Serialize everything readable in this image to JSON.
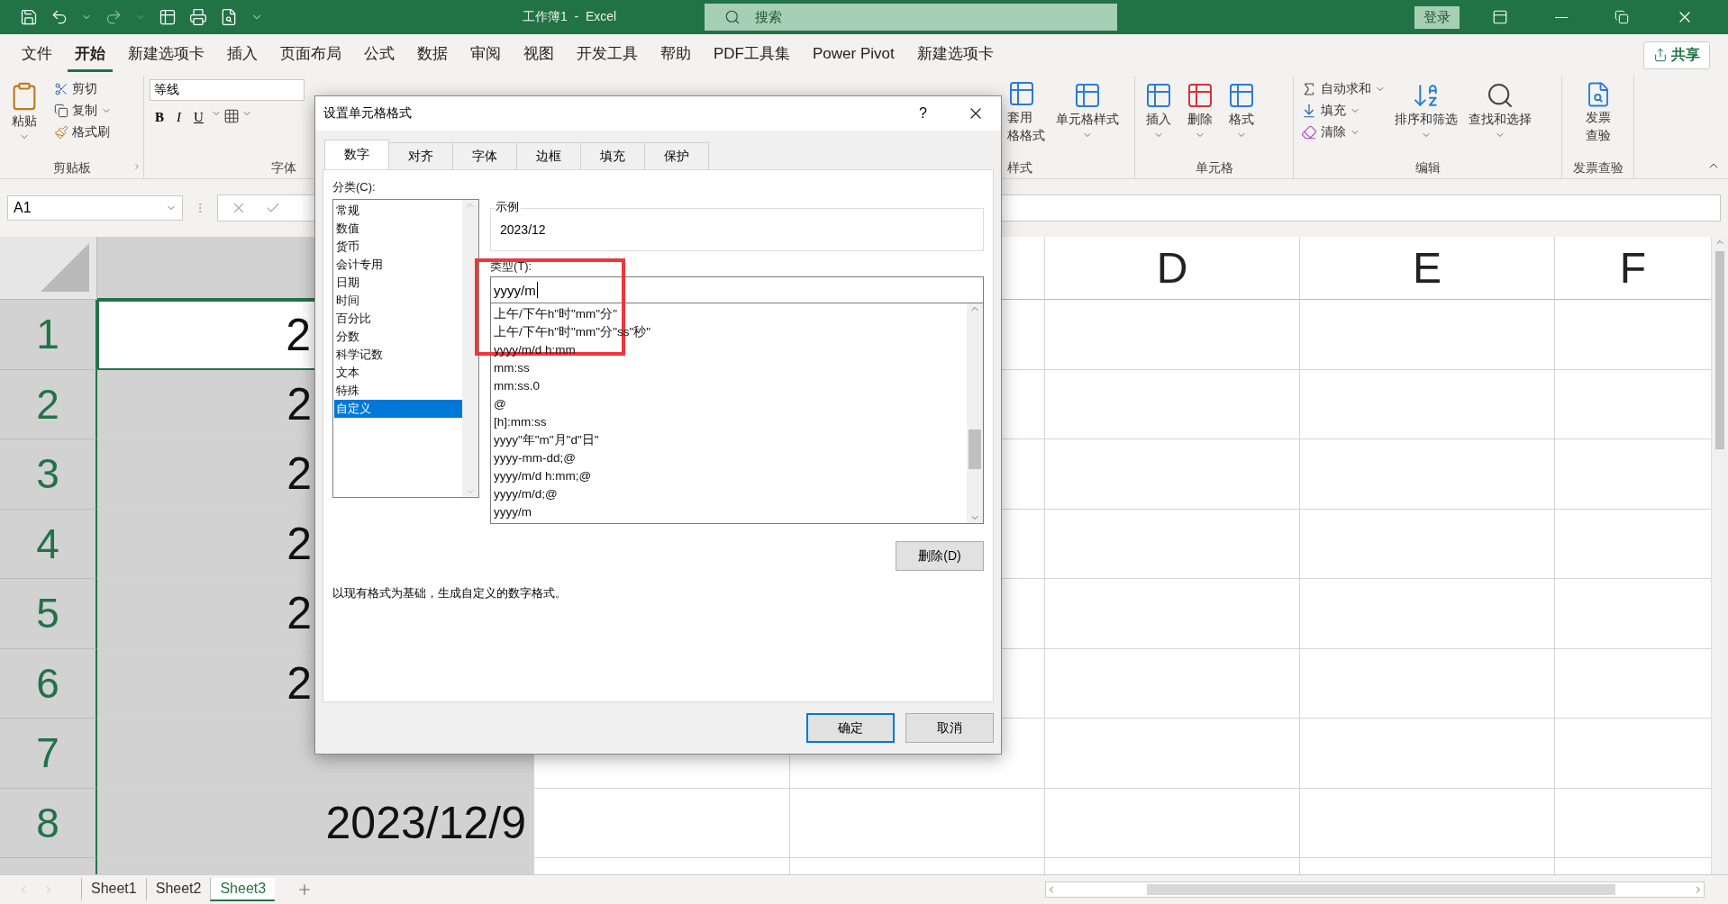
{
  "title_bar": {
    "title": "工作簿1  -  Excel",
    "search_placeholder": "搜索",
    "sign_in": "登录"
  },
  "menu_tabs": [
    {
      "label": "文件",
      "selected": false
    },
    {
      "label": "开始",
      "selected": true
    },
    {
      "label": "新建选项卡",
      "selected": false
    },
    {
      "label": "插入",
      "selected": false
    },
    {
      "label": "页面布局",
      "selected": false
    },
    {
      "label": "公式",
      "selected": false
    },
    {
      "label": "数据",
      "selected": false
    },
    {
      "label": "审阅",
      "selected": false
    },
    {
      "label": "视图",
      "selected": false
    },
    {
      "label": "开发工具",
      "selected": false
    },
    {
      "label": "帮助",
      "selected": false
    },
    {
      "label": "PDF工具集",
      "selected": false
    },
    {
      "label": "Power Pivot",
      "selected": false
    },
    {
      "label": "新建选项卡",
      "selected": false
    }
  ],
  "share": "共享",
  "ribbon_left": {
    "paste": "粘贴",
    "cut": "剪切",
    "copy": "复制",
    "format_painter": "格式刷",
    "clipboard_group": "剪贴板",
    "font_name": "等线",
    "bold": "B",
    "italic": "I",
    "underline": "U",
    "font_group": "字体"
  },
  "ribbon_right": {
    "table_format_top": "套用",
    "table_format_bottom": "格格式",
    "cell_styles": "单元格样式",
    "styles_group": "样式",
    "insert": "插入",
    "delete": "删除",
    "format": "格式",
    "cells_group": "单元格",
    "autosum": "自动求和",
    "fill": "填充",
    "clear": "清除",
    "sort_filter": "排序和筛选",
    "find_select": "查找和选择",
    "editing_group": "编辑",
    "invoice_top": "发票",
    "invoice_bottom": "查验",
    "invoice_group": "发票查验"
  },
  "name_box": "A1",
  "column_headers": [
    "D",
    "E",
    "F"
  ],
  "rows": [
    {
      "number": "1",
      "a": "2",
      "selected": true,
      "active": true
    },
    {
      "number": "2",
      "a": "2",
      "selected": true,
      "active": false
    },
    {
      "number": "3",
      "a": "2",
      "selected": true,
      "active": false
    },
    {
      "number": "4",
      "a": "2",
      "selected": true,
      "active": false
    },
    {
      "number": "5",
      "a": "2",
      "selected": true,
      "active": false
    },
    {
      "number": "6",
      "a": "2",
      "selected": true,
      "active": false
    },
    {
      "number": "7",
      "selected": true,
      "active": false
    },
    {
      "number": "8",
      "a": "2023/12/9",
      "selected": true,
      "active": false
    }
  ],
  "sheets": [
    {
      "label": "Sheet1",
      "selected": false
    },
    {
      "label": "Sheet2",
      "selected": false
    },
    {
      "label": "Sheet3",
      "selected": true
    }
  ],
  "dialog": {
    "title": "设置单元格格式",
    "help": "?",
    "tabs": [
      {
        "label": "数字",
        "selected": true
      },
      {
        "label": "对齐",
        "selected": false
      },
      {
        "label": "字体",
        "selected": false
      },
      {
        "label": "边框",
        "selected": false
      },
      {
        "label": "填充",
        "selected": false
      },
      {
        "label": "保护",
        "selected": false
      }
    ],
    "category_label": "分类(C):",
    "categories": [
      {
        "label": "常规",
        "selected": false
      },
      {
        "label": "数值",
        "selected": false
      },
      {
        "label": "货币",
        "selected": false
      },
      {
        "label": "会计专用",
        "selected": false
      },
      {
        "label": "日期",
        "selected": false
      },
      {
        "label": "时间",
        "selected": false
      },
      {
        "label": "百分比",
        "selected": false
      },
      {
        "label": "分数",
        "selected": false
      },
      {
        "label": "科学记数",
        "selected": false
      },
      {
        "label": "文本",
        "selected": false
      },
      {
        "label": "特殊",
        "selected": false
      },
      {
        "label": "自定义",
        "selected": true
      }
    ],
    "sample_label": "示例",
    "sample_value": "2023/12",
    "type_label": "类型(T):",
    "type_value": "yyyy/m",
    "formats": [
      "上午/下午h\"时\"mm\"分\"",
      "上午/下午h\"时\"mm\"分\"ss\"秒\"",
      "yyyy/m/d h:mm",
      "mm:ss",
      "mm:ss.0",
      "@",
      "[h]:mm:ss",
      "yyyy\"年\"m\"月\"d\"日\"",
      "yyyy-mm-dd;@",
      "yyyy/m/d h:mm;@",
      "yyyy/m/d;@",
      "yyyy/m"
    ],
    "delete_button": "删除(D)",
    "description": "以现有格式为基础，生成自定义的数字格式。",
    "ok": "确定",
    "cancel": "取消"
  }
}
